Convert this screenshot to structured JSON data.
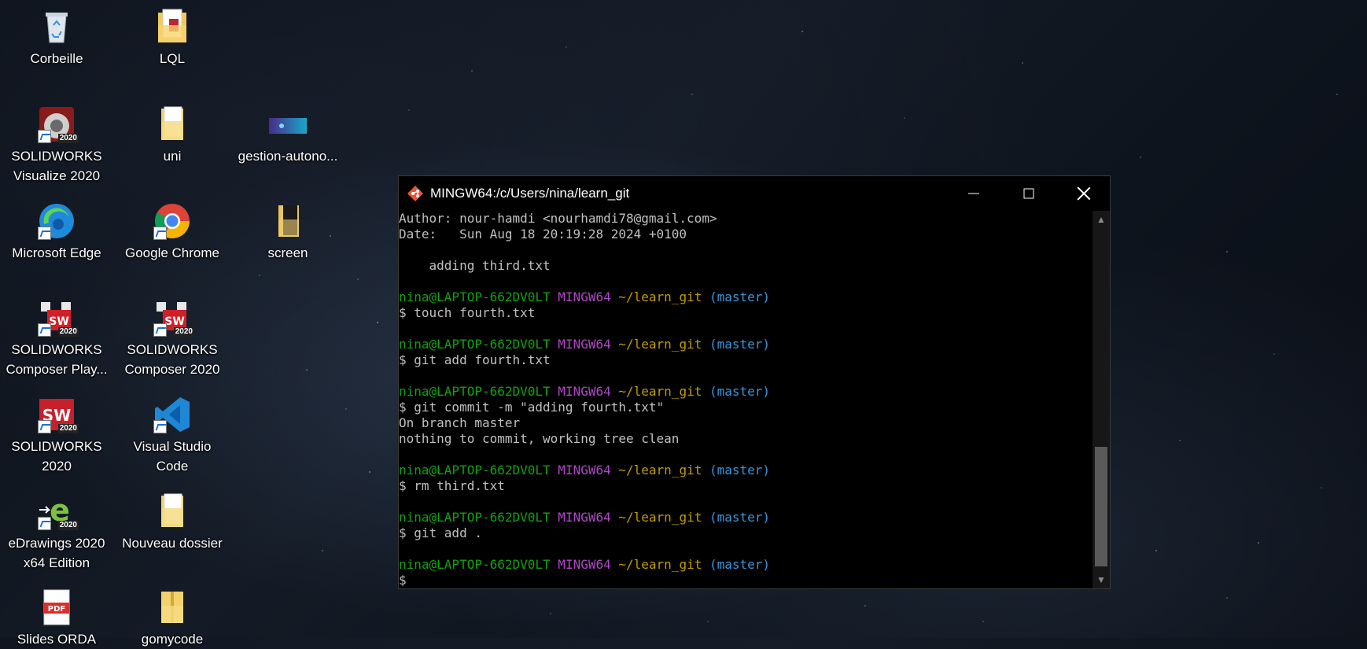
{
  "desktop": {
    "icons": [
      {
        "label": "Corbeille",
        "icon": "recycle-bin-icon"
      },
      {
        "label": "LQL",
        "icon": "folder-pdf-icon"
      },
      {
        "label": "SOLIDWORKS\nVisualize 2020",
        "icon": "solidworks-visualize-icon"
      },
      {
        "label": "uni",
        "icon": "folder-icon"
      },
      {
        "label": "gestion-autono...",
        "icon": "image-file-icon"
      },
      {
        "label": "Microsoft Edge",
        "icon": "edge-icon"
      },
      {
        "label": "Google Chrome",
        "icon": "chrome-icon"
      },
      {
        "label": "screen",
        "icon": "folder-dark-icon"
      },
      {
        "label": "SOLIDWORKS\nComposer Play...",
        "icon": "solidworks-composer-player-icon"
      },
      {
        "label": "SOLIDWORKS\nComposer 2020",
        "icon": "solidworks-composer-icon"
      },
      {
        "label": "SOLIDWORKS\n2020",
        "icon": "solidworks-icon"
      },
      {
        "label": "Visual Studio\nCode",
        "icon": "vscode-icon"
      },
      {
        "label": "eDrawings 2020\nx64 Edition",
        "icon": "edrawings-icon"
      },
      {
        "label": "Nouveau dossier",
        "icon": "folder-icon"
      },
      {
        "label": "Slides ORDA",
        "icon": "pdf-icon"
      },
      {
        "label": "gomycode",
        "icon": "folder-zip-icon"
      }
    ],
    "badge": "2020",
    "pdf_text": "PDF"
  },
  "terminal": {
    "title": "MINGW64:/c/Users/nina/learn_git",
    "prompt": {
      "user": "nina@LAPTOP-662DV0LT",
      "shell": "MINGW64",
      "path": "~/learn_git",
      "branch": "(master)"
    },
    "lines": {
      "author": "Author: nour-hamdi <nourhamdi78@gmail.com>",
      "date": "Date:   Sun Aug 18 20:19:28 2024 +0100",
      "msg": "    adding third.txt",
      "cmd1": "$ touch fourth.txt",
      "cmd2": "$ git add fourth.txt",
      "cmd3": "$ git commit -m \"adding fourth.txt\"",
      "out3a": "On branch master",
      "out3b": "nothing to commit, working tree clean",
      "cmd4": "$ rm third.txt",
      "cmd5": "$ git add .",
      "cmd6": "$"
    },
    "colors": {
      "user": "#13a10e",
      "shell": "#b148c6",
      "path": "#c19c00",
      "branch": "#3a96dd",
      "text": "#c0c0c0"
    }
  }
}
